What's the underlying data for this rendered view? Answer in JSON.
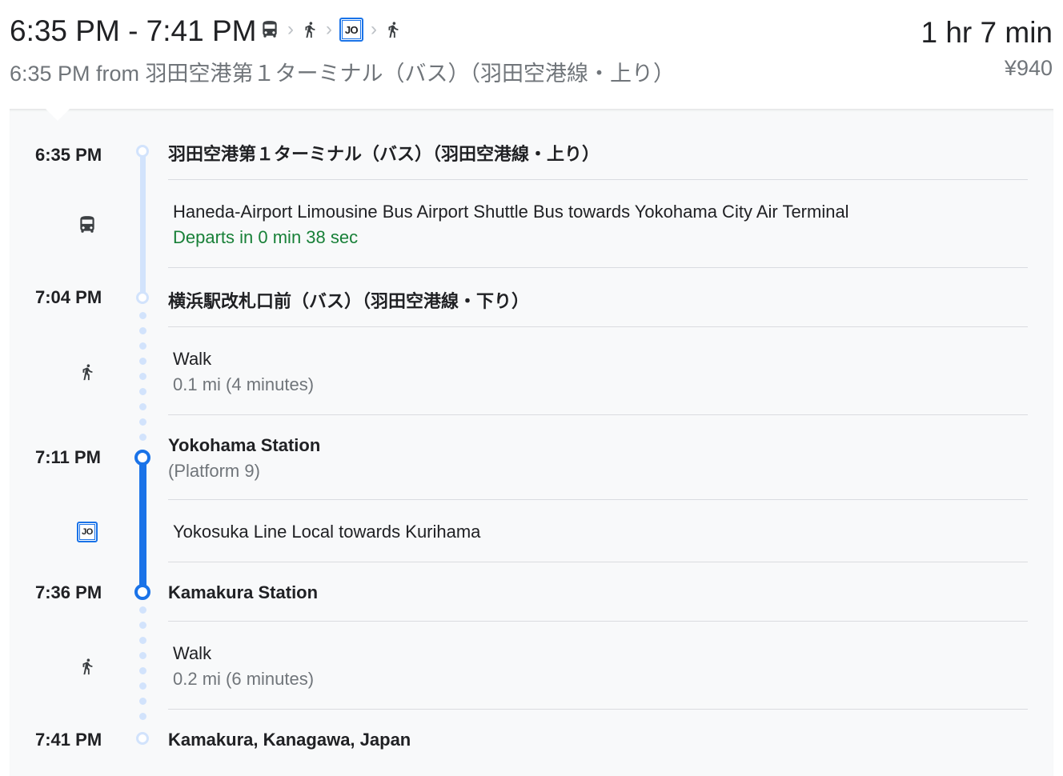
{
  "summary": {
    "time_range": "6:35 PM - 7:41 PM",
    "icons": [
      "bus-icon",
      "walk-icon",
      "jo-line-icon",
      "walk-icon"
    ],
    "subtitle": "6:35 PM from 羽田空港第１ターミナル（バス）（羽田空港線・上り）",
    "duration": "1 hr 7 min",
    "fare": "¥940"
  },
  "line_badge": "JO",
  "colors": {
    "bus_line": "#d2e3fc",
    "rail_line": "#1a73e8",
    "realtime_green": "#188038",
    "muted_text": "#70757a"
  },
  "stops": [
    {
      "time": "6:35 PM",
      "name": "羽田空港第１ターミナル（バス）（羽田空港線・上り）"
    },
    {
      "time": "7:04 PM",
      "name": "横浜駅改札口前（バス）（羽田空港線・下り）"
    },
    {
      "time": "7:11 PM",
      "name": "Yokohama Station",
      "platform": "(Platform 9)"
    },
    {
      "time": "7:36 PM",
      "name": "Kamakura Station"
    },
    {
      "time": "7:41 PM",
      "name": "Kamakura, Kanagawa, Japan"
    }
  ],
  "legs": [
    {
      "mode": "bus-icon",
      "description": "Haneda-Airport Limousine Bus Airport Shuttle Bus towards Yokohama City Air Terminal",
      "status": "Departs in 0 min 38 sec"
    },
    {
      "mode": "walk-icon",
      "description": "Walk",
      "detail": "0.1 mi (4 minutes)"
    },
    {
      "mode": "jo-line-icon",
      "description": "Yokosuka Line Local towards Kurihama"
    },
    {
      "mode": "walk-icon",
      "description": "Walk",
      "detail": "0.2 mi (6 minutes)"
    }
  ]
}
